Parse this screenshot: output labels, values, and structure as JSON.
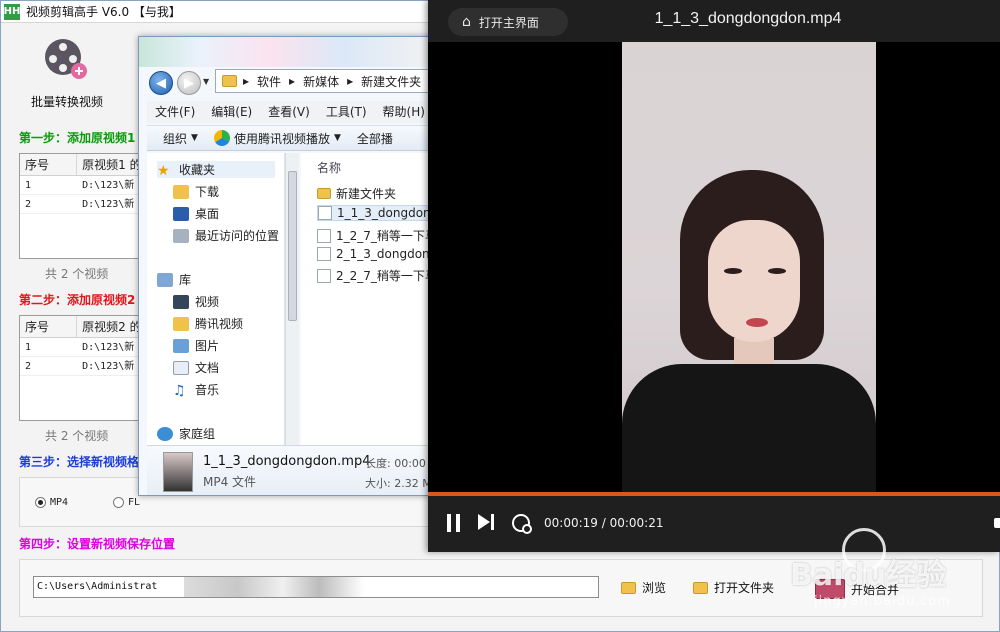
{
  "app": {
    "title": "视频剪辑高手 V6.0  【与我】",
    "logo": "HH",
    "batch_label": "批量转换视频",
    "step1": "第一步：添加原视频1",
    "step2": "第二步：添加原视频2",
    "step3": "第三步：选择新视频格",
    "step4": "第四步：设置新视频保存位置",
    "list1": {
      "headers": [
        "序号",
        "原视频1 的"
      ],
      "rows": [
        [
          "1",
          "D:\\123\\新"
        ],
        [
          "2",
          "D:\\123\\新"
        ]
      ],
      "count": "共 2 个视频"
    },
    "list2": {
      "headers": [
        "序号",
        "原视频2 的"
      ],
      "rows": [
        [
          "1",
          "D:\\123\\新"
        ],
        [
          "2",
          "D:\\123\\新"
        ]
      ],
      "count": "共 2 个视频"
    },
    "format_options": [
      "MP4",
      "FL"
    ],
    "save_path": "C:\\Users\\Administrat",
    "browse_label": "浏览",
    "open_folder_label": "打开文件夹",
    "start_merge_label": "开始合并",
    "colors": {
      "step1": "#0a9a0a",
      "step2": "#e0161a",
      "step3": "#1a3fd6",
      "step4": "#e000e0"
    }
  },
  "explorer": {
    "breadcrumb": [
      "软件",
      "新媒体",
      "新建文件夹"
    ],
    "menu": [
      "文件(F)",
      "编辑(E)",
      "查看(V)",
      "工具(T)",
      "帮助(H)"
    ],
    "toolbar": {
      "organize": "组织",
      "play_tencent": "使用腾讯视频播放",
      "play_all": "全部播"
    },
    "nav": {
      "favorites": "收藏夹",
      "downloads": "下载",
      "desktop": "桌面",
      "recent": "最近访问的位置",
      "library": "库",
      "videos": "视频",
      "tencent_video": "腾讯视频",
      "pictures": "图片",
      "documents": "文档",
      "music": "音乐",
      "homegroup": "家庭组"
    },
    "column_name": "名称",
    "files": [
      "新建文件夹",
      "1_1_3_dongdon",
      "1_2_7_稍等一下马",
      "2_1_3_dongdon",
      "2_2_7_稍等一下马"
    ],
    "details": {
      "name": "1_1_3_dongdongdon.mp4",
      "type": "MP4 文件",
      "length": "长度: 00:00",
      "size": "大小: 2.32 M"
    }
  },
  "player": {
    "home_label": "打开主界面",
    "title": "1_1_3_dongdongdon.mp4",
    "time": "00:00:19 / 00:00:21",
    "progress": 0.905,
    "accent": "#e0541e"
  },
  "watermark": {
    "text": "Baidu经验",
    "url": "jingyan.baidu.com"
  }
}
